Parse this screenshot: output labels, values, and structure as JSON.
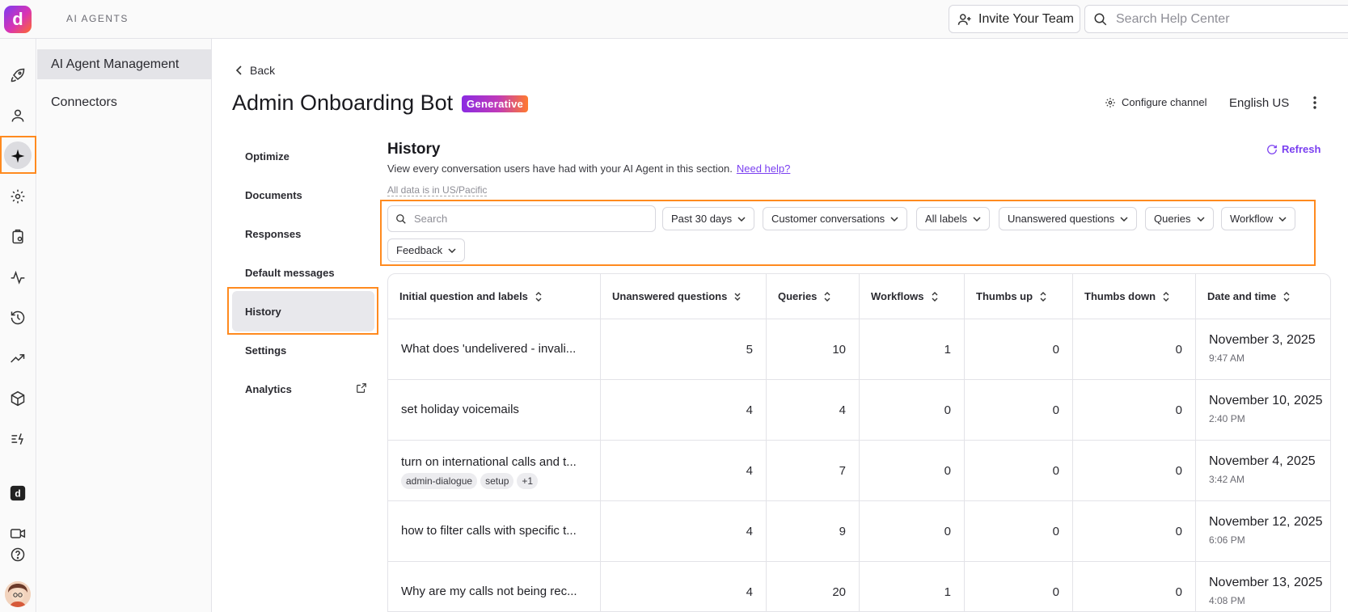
{
  "header": {
    "section_title": "AI AGENTS",
    "invite_label": "Invite Your Team",
    "help_search_placeholder": "Search Help Center"
  },
  "subnav": {
    "items": [
      {
        "label": "AI Agent Management",
        "active": true
      },
      {
        "label": "Connectors",
        "active": false
      }
    ]
  },
  "page": {
    "back_label": "Back",
    "title": "Admin Onboarding Bot",
    "badge": "Generative",
    "configure_label": "Configure channel",
    "language": "English US"
  },
  "tabs": [
    {
      "label": "Optimize"
    },
    {
      "label": "Documents"
    },
    {
      "label": "Responses"
    },
    {
      "label": "Default messages"
    },
    {
      "label": "History",
      "active": true
    },
    {
      "label": "Settings"
    },
    {
      "label": "Analytics"
    }
  ],
  "history": {
    "title": "History",
    "description": "View every conversation users have had with your AI Agent in this section.",
    "need_help": "Need help?",
    "timezone_note": "All data is in US/Pacific",
    "refresh_label": "Refresh",
    "search_placeholder": "Search",
    "filters": [
      "Past 30 days",
      "Customer conversations",
      "All labels",
      "Unanswered questions",
      "Queries",
      "Workflow",
      "Feedback"
    ]
  },
  "table": {
    "columns": [
      "Initial question and labels",
      "Unanswered questions",
      "Queries",
      "Workflows",
      "Thumbs up",
      "Thumbs down",
      "Date and time"
    ],
    "rows": [
      {
        "question": "What does 'undelivered - invali...",
        "tags": [],
        "unanswered": "5",
        "queries": "10",
        "workflows": "1",
        "up": "0",
        "down": "0",
        "date": "November 3, 2025",
        "time": "9:47 AM"
      },
      {
        "question": "set holiday voicemails",
        "tags": [],
        "unanswered": "4",
        "queries": "4",
        "workflows": "0",
        "up": "0",
        "down": "0",
        "date": "November 10, 2025",
        "time": "2:40 PM"
      },
      {
        "question": "turn on international calls and t...",
        "tags": [
          "admin-dialogue",
          "setup",
          "+1"
        ],
        "unanswered": "4",
        "queries": "7",
        "workflows": "0",
        "up": "0",
        "down": "0",
        "date": "November 4, 2025",
        "time": "3:42 AM"
      },
      {
        "question": "how to filter calls with specific t...",
        "tags": [],
        "unanswered": "4",
        "queries": "9",
        "workflows": "0",
        "up": "0",
        "down": "0",
        "date": "November 12, 2025",
        "time": "6:06 PM"
      },
      {
        "question": "Why are my calls not being rec...",
        "tags": [],
        "unanswered": "4",
        "queries": "20",
        "workflows": "1",
        "up": "0",
        "down": "0",
        "date": "November 13, 2025",
        "time": "4:08 PM"
      }
    ]
  },
  "colors": {
    "accent_purple": "#7a3ff0",
    "highlight_orange": "#ff8a1f",
    "badge_gradient_start": "#8a2be2",
    "badge_gradient_end": "#ff7a2f"
  }
}
